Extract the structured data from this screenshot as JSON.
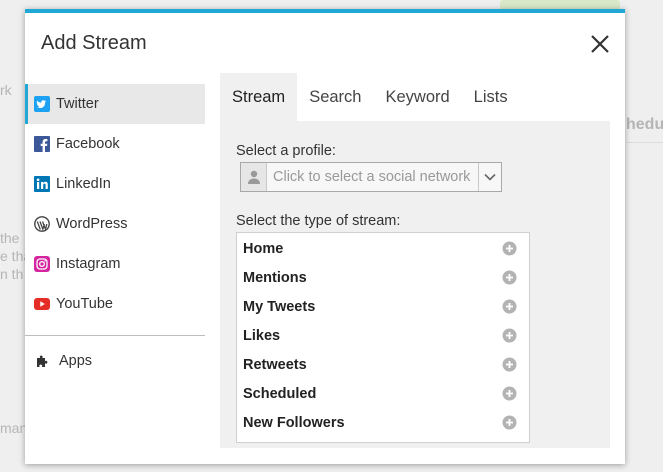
{
  "modal": {
    "title": "Add Stream"
  },
  "background": {
    "fragments": [
      "rk",
      "hedu",
      "the",
      "e tha",
      "n th",
      "man"
    ]
  },
  "networks": [
    {
      "label": "Twitter",
      "icon": "twitter-icon",
      "color": "#1da1f2"
    },
    {
      "label": "Facebook",
      "icon": "facebook-icon",
      "color": "#3b5998"
    },
    {
      "label": "LinkedIn",
      "icon": "linkedin-icon",
      "color": "#0077b5"
    },
    {
      "label": "WordPress",
      "icon": "wordpress-icon",
      "color": "#464646"
    },
    {
      "label": "Instagram",
      "icon": "instagram-icon",
      "color": "#d6249f"
    },
    {
      "label": "YouTube",
      "icon": "youtube-icon",
      "color": "#e52d27"
    }
  ],
  "apps": {
    "label": "Apps",
    "icon": "puzzle-icon"
  },
  "tabs": [
    "Stream",
    "Search",
    "Keyword",
    "Lists"
  ],
  "profile": {
    "label": "Select a profile:",
    "placeholder": "Click to select a social network"
  },
  "stream_type": {
    "label": "Select the type of stream:",
    "items": [
      "Home",
      "Mentions",
      "My Tweets",
      "Likes",
      "Retweets",
      "Scheduled",
      "New Followers"
    ]
  },
  "colors": {
    "accent": "#20a7d6"
  }
}
